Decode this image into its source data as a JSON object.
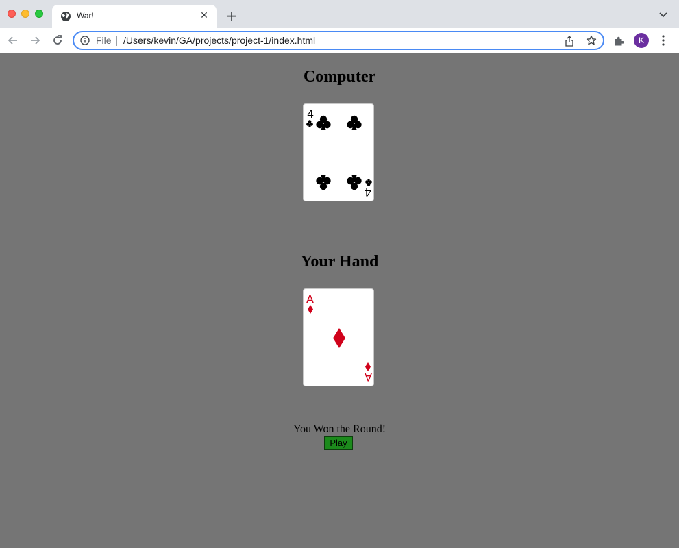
{
  "browser": {
    "tab_title": "War!",
    "tab_close_glyph": "✕",
    "new_tab_glyph": "+",
    "scheme_label": "File",
    "url": "/Users/kevin/GA/projects/project-1/index.html",
    "avatar_initial": "K",
    "accent_color": "#4a8af4",
    "avatar_color": "#6b2fa0"
  },
  "game": {
    "computer_heading": "Computer",
    "player_heading": "Your Hand",
    "computer_card": {
      "rank": "4",
      "suit": "clubs",
      "suit_glyph": "♣",
      "color": "#000000"
    },
    "player_card": {
      "rank": "A",
      "suit": "diamonds",
      "suit_glyph": "♦",
      "color": "#d0021b"
    },
    "status_text": "You Won the Round!",
    "play_label": "Play",
    "play_color": "#1c8a1c",
    "background_color": "#757575"
  }
}
